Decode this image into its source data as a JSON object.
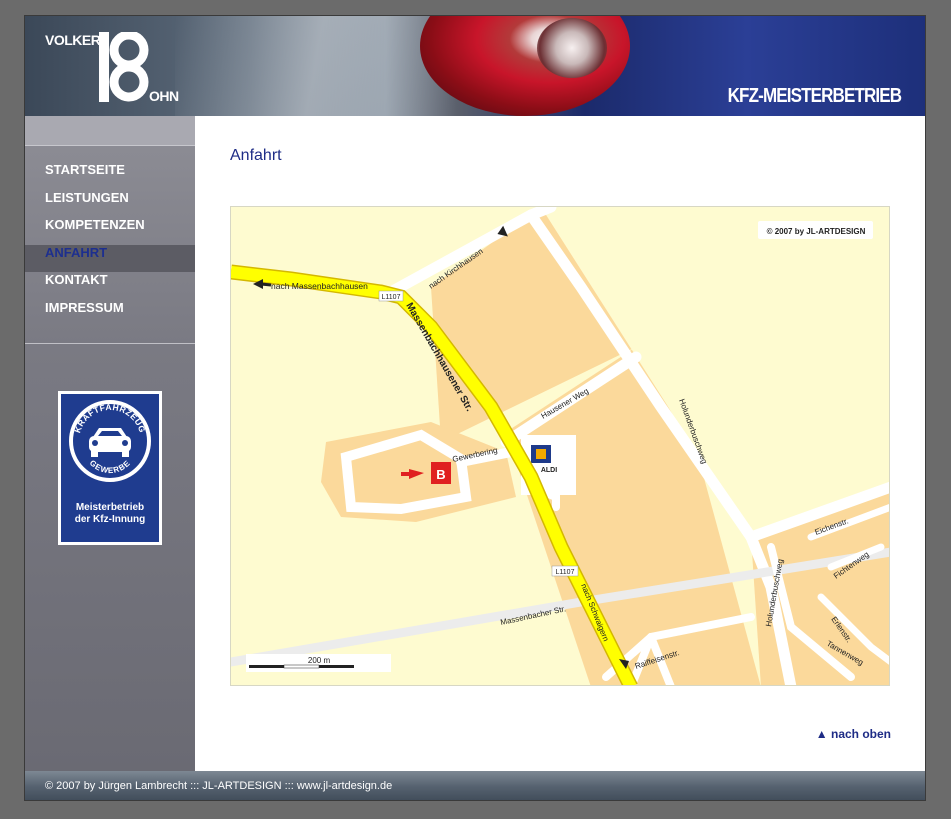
{
  "header": {
    "logo_first": "VOLKER",
    "logo_last": "OHN",
    "tagline": "KFZ-MEISTERBETRIEB"
  },
  "nav": {
    "items": [
      {
        "label": "STARTSEITE"
      },
      {
        "label": "LEISTUNGEN"
      },
      {
        "label": "KOMPETENZEN"
      },
      {
        "label": "ANFAHRT",
        "active": true
      },
      {
        "label": "KONTAKT"
      },
      {
        "label": "IMPRESSUM"
      }
    ]
  },
  "badge": {
    "top_text": "KRAFTFAHRZEUG",
    "bottom_text": "GEWERBE",
    "line1": "Meisterbetrieb",
    "line2": "der Kfz-Innung"
  },
  "main": {
    "title": "Anfahrt",
    "back_to_top": "▲ nach oben"
  },
  "map": {
    "copyright": "© 2007 by JL-ARTDESIGN",
    "labels": {
      "massenbachhausen": "nach Massenbachhausen",
      "kirchhausen": "nach Kirchhausen",
      "l1107_top": "L1107",
      "l1107_bottom": "L1107",
      "main_street": "Massenbachhausener Str.",
      "hausener_weg": "Hausener Weg",
      "gewerbering": "Gewerbering",
      "aldi": "ALDI",
      "holunderbuschweg": "Holunderbuschweg",
      "holunderbuschweg2": "Holunderbuschweg",
      "eichenstr": "Eichenstr.",
      "fichtenweg": "Fichtenweg",
      "erlenstr": "Erlenstr.",
      "tannenweg": "Tannenweg",
      "massenbacher": "Massenbacher Str.",
      "schwaigern": "nach Schwaigern",
      "raiffeisen": "Raiffeisenstr.",
      "scale": "200 m"
    }
  },
  "footer": {
    "text": "© 2007 by Jürgen Lambrecht ::: JL-ARTDESIGN ::: www.jl-artdesign.de"
  },
  "colors": {
    "nav_active": "#1d2f8f",
    "title": "#1e2c86",
    "map_bg": "#fefbd0",
    "map_block": "#fbd99b",
    "main_road": "#ffff00"
  }
}
